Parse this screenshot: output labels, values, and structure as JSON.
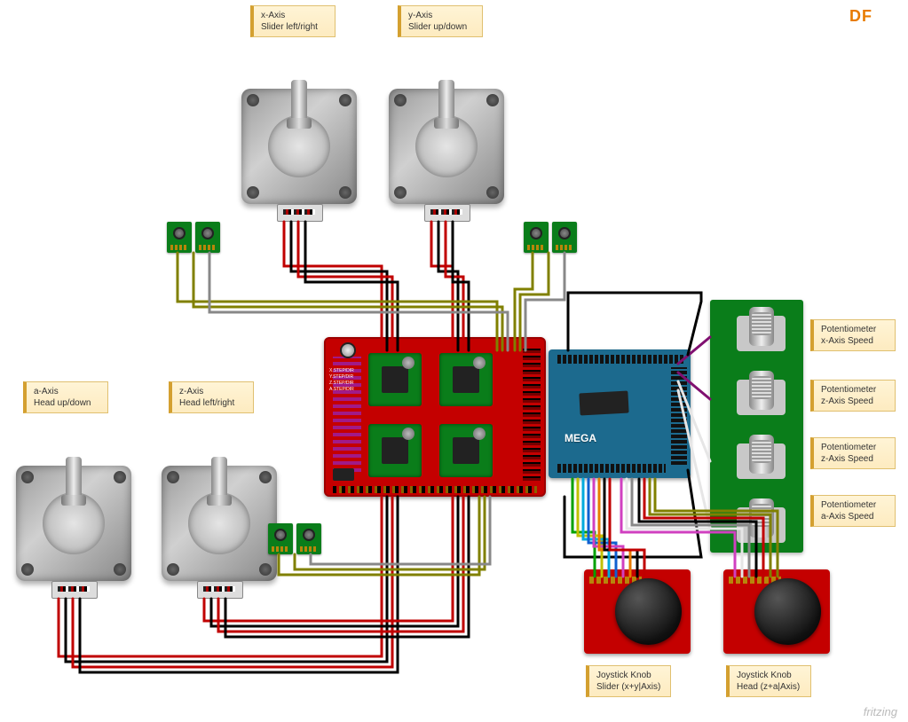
{
  "brand": "DF",
  "footer": "fritzing",
  "mega_label": "MEGA",
  "shield_pins_text": "X.STEP/DIR\nY.STEP/DIR\nZ.STEP/DIR\nA.STEP/DIR",
  "steppers": [
    {
      "id": "x",
      "label_line1": "x-Axis",
      "label_line2": "Slider left/right"
    },
    {
      "id": "y",
      "label_line1": "y-Axis",
      "label_line2": "Slider up/down"
    },
    {
      "id": "a",
      "label_line1": "a-Axis",
      "label_line2": "Head up/down"
    },
    {
      "id": "z",
      "label_line1": "z-Axis",
      "label_line2": "Head left/right"
    }
  ],
  "potentiometers": [
    {
      "label_line1": "Potentiometer",
      "label_line2": "x-Axis Speed"
    },
    {
      "label_line1": "Potentiometer",
      "label_line2": "z-Axis Speed"
    },
    {
      "label_line1": "Potentiometer",
      "label_line2": "z-Axis Speed"
    },
    {
      "label_line1": "Potentiometer",
      "label_line2": "a-Axis Speed"
    }
  ],
  "joysticks": [
    {
      "label_line1": "Joystick Knob",
      "label_line2": "Slider (x+y|Axis)"
    },
    {
      "label_line1": "Joystick Knob",
      "label_line2": "Head (z+a|Axis)"
    }
  ],
  "chart_data": {
    "type": "wiring-diagram",
    "microcontroller": "Arduino MEGA",
    "shield": "CNC Shield (4× stepper drivers)",
    "stepper_motors": [
      {
        "axis": "x",
        "function": "Slider left/right",
        "limit_switches": 2
      },
      {
        "axis": "y",
        "function": "Slider up/down",
        "limit_switches": 2
      },
      {
        "axis": "z",
        "function": "Head left/right",
        "limit_switches": 2
      },
      {
        "axis": "a",
        "function": "Head up/down",
        "limit_switches": 0
      }
    ],
    "potentiometers": [
      {
        "controls": "x-Axis Speed"
      },
      {
        "controls": "z-Axis Speed"
      },
      {
        "controls": "z-Axis Speed"
      },
      {
        "controls": "a-Axis Speed"
      }
    ],
    "joysticks": [
      {
        "controls": "Slider (x+y Axis)"
      },
      {
        "controls": "Head (z+a Axis)"
      }
    ],
    "wire_colors_present": [
      "red",
      "black",
      "grey",
      "olive",
      "green",
      "yellow",
      "blue",
      "magenta",
      "white",
      "orange",
      "cyan"
    ]
  }
}
